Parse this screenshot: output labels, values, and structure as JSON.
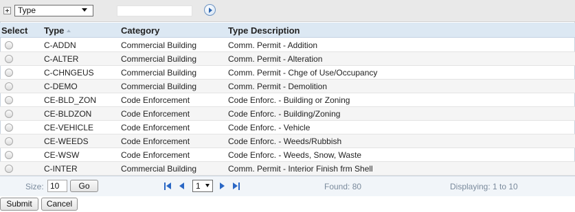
{
  "filter": {
    "field_value": "Type",
    "search_value": ""
  },
  "columns": {
    "select": "Select",
    "type": "Type",
    "category": "Category",
    "description": "Type Description"
  },
  "rows": [
    {
      "type": "C-ADDN",
      "category": "Commercial Building",
      "description": "Comm. Permit - Addition"
    },
    {
      "type": "C-ALTER",
      "category": "Commercial Building",
      "description": "Comm. Permit - Alteration"
    },
    {
      "type": "C-CHNGEUS",
      "category": "Commercial Building",
      "description": "Comm. Permit - Chge of Use/Occupancy"
    },
    {
      "type": "C-DEMO",
      "category": "Commercial Building",
      "description": "Comm. Permit - Demolition"
    },
    {
      "type": "CE-BLD_ZON",
      "category": "Code Enforcement",
      "description": "Code Enforc. - Building or Zoning"
    },
    {
      "type": "CE-BLDZON",
      "category": "Code Enforcement",
      "description": "Code Enforc. - Building/Zoning"
    },
    {
      "type": "CE-VEHICLE",
      "category": "Code Enforcement",
      "description": "Code Enforc. - Vehicle"
    },
    {
      "type": "CE-WEEDS",
      "category": "Code Enforcement",
      "description": "Code Enforc. - Weeds/Rubbish"
    },
    {
      "type": "CE-WSW",
      "category": "Code Enforcement",
      "description": "Code Enforc. - Weeds, Snow, Waste"
    },
    {
      "type": "C-INTER",
      "category": "Commercial Building",
      "description": "Comm. Permit - Interior Finish frm Shell"
    }
  ],
  "pager": {
    "size_label": "Size:",
    "size_value": "10",
    "go_label": "Go",
    "page_value": "1",
    "found_text": "Found: 80",
    "displaying_text": "Displaying: 1 to 10"
  },
  "actions": {
    "submit_label": "Submit",
    "cancel_label": "Cancel"
  },
  "icons": {
    "expand": "plus-box-icon",
    "search_go": "circle-arrow-right-icon",
    "first": "first-page-icon",
    "prev": "prev-page-icon",
    "next": "next-page-icon",
    "last": "last-page-icon"
  },
  "colors": {
    "header_bg": "#dce8f3",
    "pager_icon": "#2a67c5",
    "muted_text": "#7a8a9c"
  }
}
